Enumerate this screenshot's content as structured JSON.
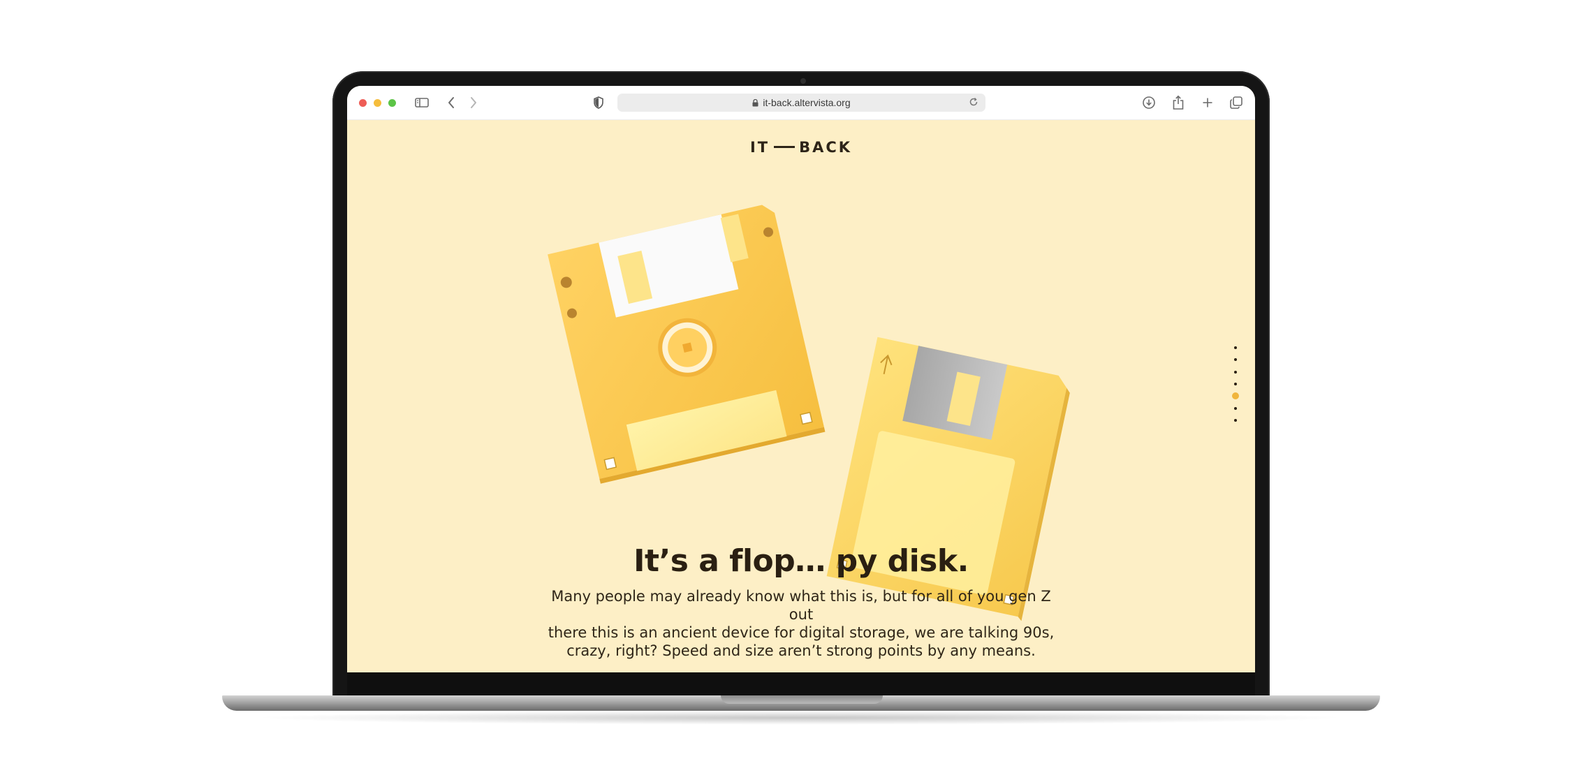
{
  "browser": {
    "url": "it-back.altervista.org"
  },
  "site": {
    "logo_left": "IT",
    "logo_right": "BACK"
  },
  "hero": {
    "headline": "It’s a flop… py disk.",
    "body_line1": "Many people may already know what this is, but for all of you gen Z out",
    "body_line2": "there this is an ancient device for digital storage, we are talking 90s,",
    "body_line3": "crazy, right? Speed and size aren’t strong points by any means."
  },
  "pager": {
    "total": 7,
    "active_index": 4
  },
  "colors": {
    "page_background": "#fdefc6",
    "disk_yellow": "#ffcd55",
    "accent": "#f0b53c",
    "text_dark": "#2a1f12"
  },
  "icons": [
    "sidebar-icon",
    "back-icon",
    "forward-icon",
    "shield-icon",
    "lock-icon",
    "reload-icon",
    "download-icon",
    "share-icon",
    "new-tab-icon",
    "tabs-overview-icon",
    "floppy-disk-illustration"
  ]
}
